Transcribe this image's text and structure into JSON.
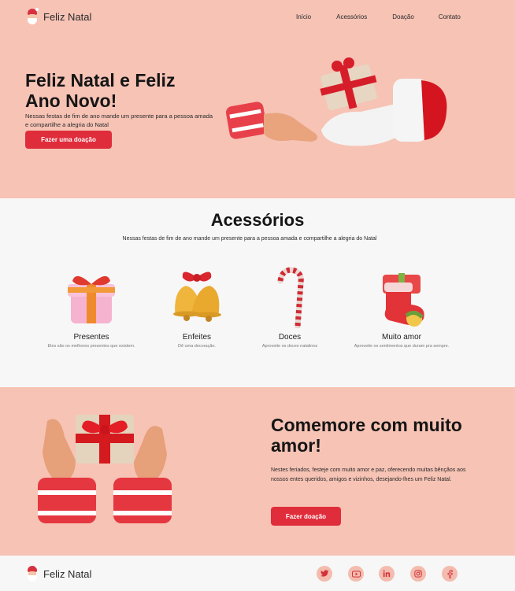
{
  "header": {
    "brand": "Feliz Natal",
    "nav": [
      "Início",
      "Acessórios",
      "Doação",
      "Contato"
    ]
  },
  "hero": {
    "title": "Feliz Natal e Feliz Ano Novo!",
    "text": "Nessas festas de fim de ano mande um presente para a pessoa amada e compartilhe a alegria do Natal",
    "button": "Fazer uma doação"
  },
  "accessories": {
    "title": "Acessórios",
    "subtitle": "Nessas festas de fim de ano mande um presente para a pessoa amada e compartilhe a alegria do Natal",
    "items": [
      {
        "name": "Presentes",
        "desc": "Eles são os melhores presentes que existem.",
        "icon": "gift-icon"
      },
      {
        "name": "Enfeites",
        "desc": "Dê uma decoração.",
        "icon": "bells-icon"
      },
      {
        "name": "Doces",
        "desc": "Aproveite os doces natalinos",
        "icon": "candy-cane-icon"
      },
      {
        "name": "Muito amor",
        "desc": "Aproveite os sentimentos que duram pra sempre.",
        "icon": "stocking-icon"
      }
    ]
  },
  "love": {
    "title": "Comemore com muito amor!",
    "text": "Nestes feriados, festeje com muito amor e paz, oferecendo muitas bênçãos aos nossos entes queridos, amigos e vizinhos, desejando-lhes um Feliz Natal.",
    "button": "Fazer doação"
  },
  "footer": {
    "brand": "Feliz Natal",
    "social": [
      "twitter-icon",
      "youtube-icon",
      "linkedin-icon",
      "instagram-icon",
      "facebook-icon"
    ]
  },
  "colors": {
    "accent": "#e02d3b",
    "background": "#f6c3b5",
    "section": "#f7f7f7"
  }
}
